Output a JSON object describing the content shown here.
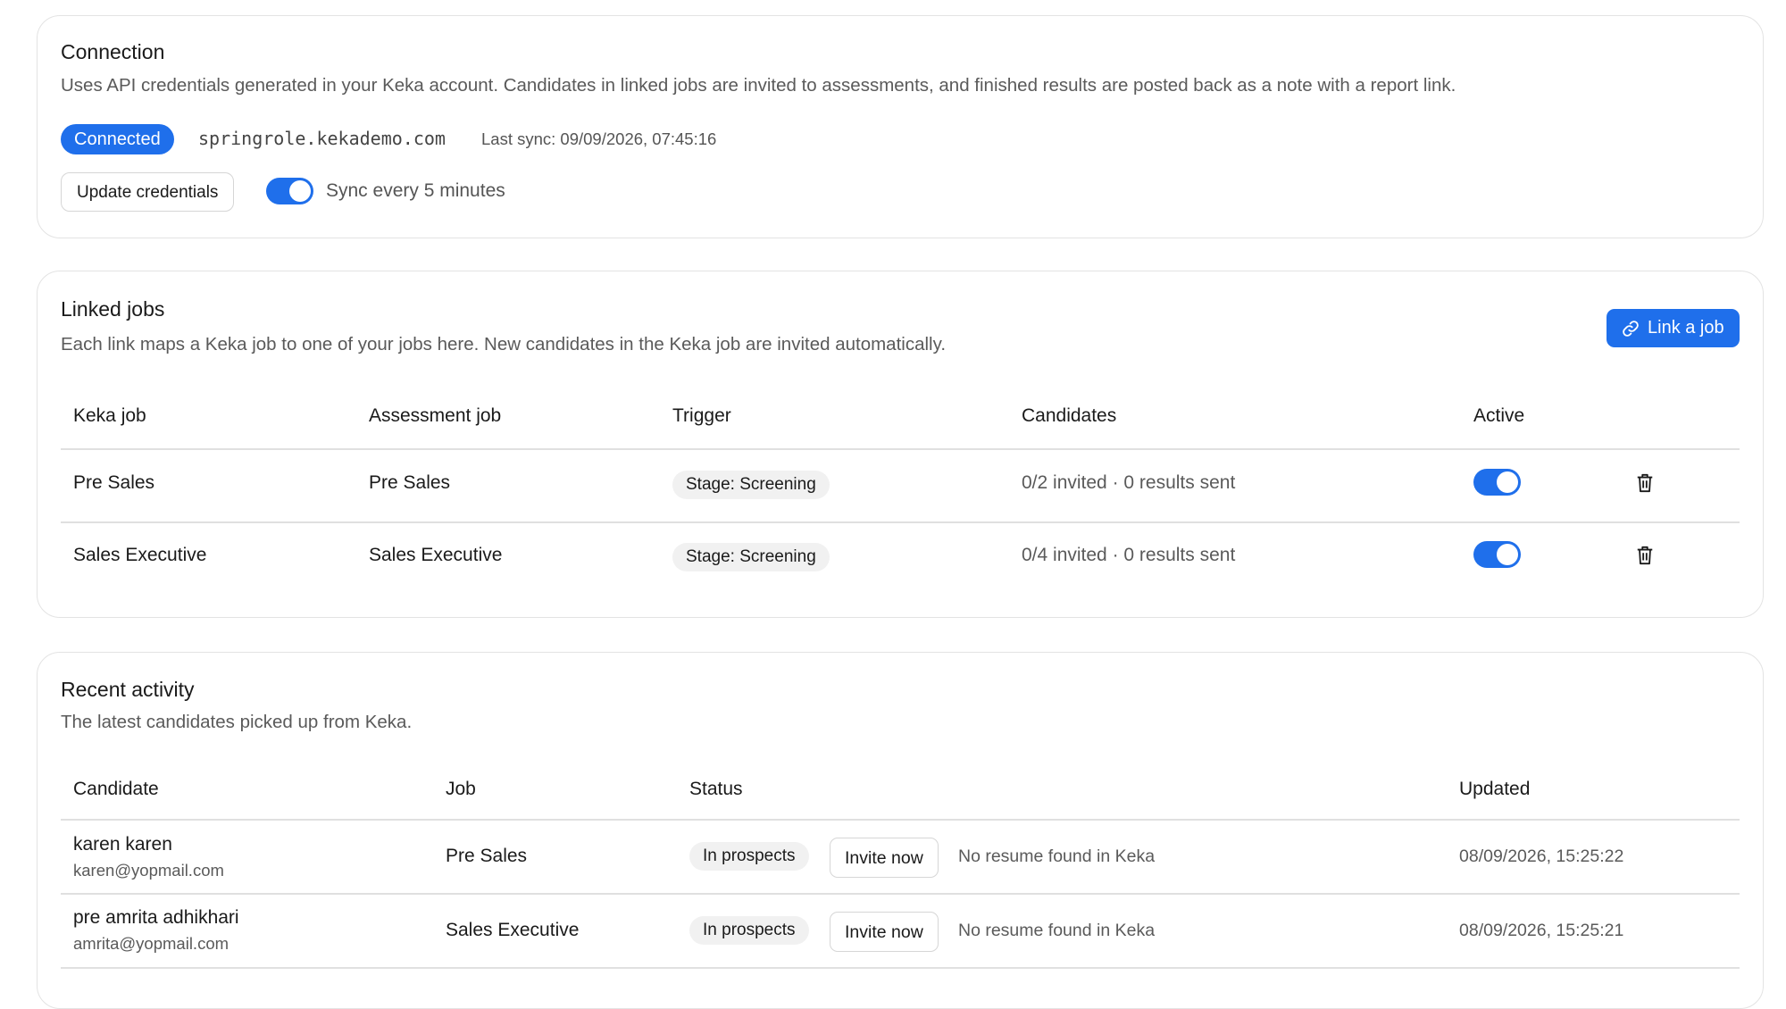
{
  "connection": {
    "title": "Connection",
    "description": "Uses API credentials generated in your Keka account. Candidates in linked jobs are invited to assessments, and finished results are posted back as a note with a report link.",
    "status_badge": "Connected",
    "domain": "springrole.kekademo.com",
    "last_sync": "Last sync: 09/09/2026, 07:45:16",
    "update_button": "Update credentials",
    "sync_toggle_on": true,
    "sync_label": "Sync every 5 minutes"
  },
  "linked_jobs": {
    "title": "Linked jobs",
    "description": "Each link maps a Keka job to one of your jobs here. New candidates in the Keka job are invited automatically.",
    "link_button": "Link a job",
    "columns": [
      "Keka job",
      "Assessment job",
      "Trigger",
      "Candidates",
      "Active"
    ],
    "rows": [
      {
        "keka_job": "Pre Sales",
        "assessment_job": "Pre Sales",
        "trigger": "Stage: Screening",
        "candidates": "0/2 invited · 0 results sent",
        "active": true
      },
      {
        "keka_job": "Sales Executive",
        "assessment_job": "Sales Executive",
        "trigger": "Stage: Screening",
        "candidates": "0/4 invited · 0 results sent",
        "active": true
      }
    ]
  },
  "recent_activity": {
    "title": "Recent activity",
    "description": "The latest candidates picked up from Keka.",
    "columns": [
      "Candidate",
      "Job",
      "Status",
      "Updated"
    ],
    "rows": [
      {
        "name": "karen karen",
        "email": "karen@yopmail.com",
        "job": "Pre Sales",
        "status": "In prospects",
        "invite_button": "Invite now",
        "note": "No resume found in Keka",
        "updated": "08/09/2026, 15:25:22"
      },
      {
        "name": "pre amrita adhikhari",
        "email": "amrita@yopmail.com",
        "job": "Sales Executive",
        "status": "In prospects",
        "invite_button": "Invite now",
        "note": "No resume found in Keka",
        "updated": "08/09/2026, 15:25:21"
      }
    ]
  },
  "colors": {
    "accent": "#1f6feb",
    "pill_bg": "#f1f1f1",
    "border": "#e3e3e3"
  },
  "icons": {
    "link_button": "link-icon",
    "delete": "trash-icon"
  }
}
